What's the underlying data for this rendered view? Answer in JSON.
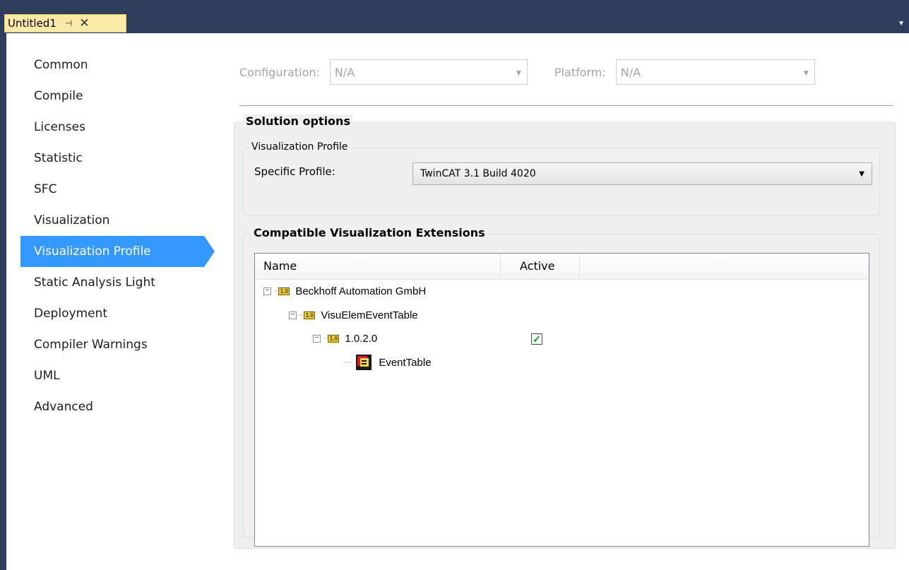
{
  "tab": {
    "title": "Untitled1",
    "pin": "⊣",
    "close": "✕"
  },
  "sidebar": {
    "items": [
      {
        "label": "Common"
      },
      {
        "label": "Compile"
      },
      {
        "label": "Licenses"
      },
      {
        "label": "Statistic"
      },
      {
        "label": "SFC"
      },
      {
        "label": "Visualization"
      },
      {
        "label": "Visualization Profile",
        "selected": true
      },
      {
        "label": "Static Analysis Light"
      },
      {
        "label": "Deployment"
      },
      {
        "label": "Compiler Warnings"
      },
      {
        "label": "UML"
      },
      {
        "label": "Advanced"
      }
    ]
  },
  "config": {
    "configuration_label": "Configuration:",
    "configuration_value": "N/A",
    "platform_label": "Platform:",
    "platform_value": "N/A"
  },
  "solution_options": {
    "title": "Solution options",
    "profile_group_title": "Visualization Profile",
    "specific_profile_label": "Specific Profile:",
    "specific_profile_value": "TwinCAT 3.1 Build 4020"
  },
  "extensions": {
    "title": "Compatible Visualization Extensions",
    "columns": {
      "name": "Name",
      "active": "Active"
    },
    "tree": [
      {
        "label": "Beckhoff Automation GmbH",
        "level": 0
      },
      {
        "label": "VisuElemEventTable",
        "level": 1
      },
      {
        "label": "1.0.2.0",
        "level": 2,
        "active": true
      },
      {
        "label": "EventTable",
        "level": 3
      }
    ],
    "lib_icon_text": "1.0"
  },
  "colors": {
    "accent": "#3399ff",
    "titlebar": "#2d3e5c",
    "tab": "#fbe9a7"
  }
}
